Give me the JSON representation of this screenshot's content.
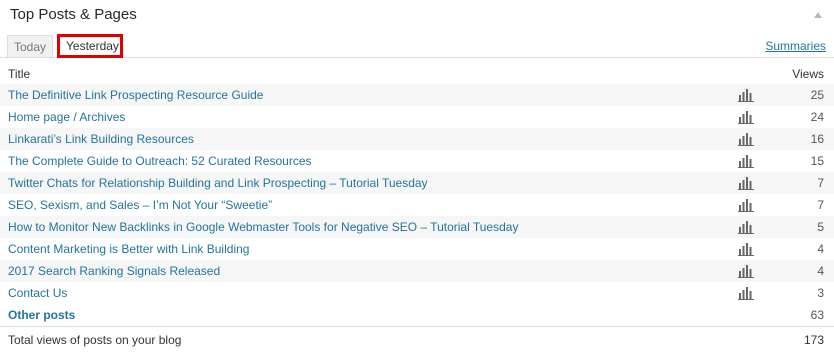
{
  "widget": {
    "title": "Top Posts & Pages",
    "tabs": [
      {
        "label": "Today",
        "active": false
      },
      {
        "label": "Yesterday",
        "active": true
      }
    ],
    "summaries_link": "Summaries",
    "columns": {
      "title": "Title",
      "views": "Views"
    }
  },
  "rows": [
    {
      "title": "The Definitive Link Prospecting Resource Guide",
      "views": "25"
    },
    {
      "title": "Home page / Archives",
      "views": "24"
    },
    {
      "title": "Linkarati’s Link Building Resources",
      "views": "16"
    },
    {
      "title": "The Complete Guide to Outreach: 52 Curated Resources",
      "views": "15"
    },
    {
      "title": "Twitter Chats for Relationship Building and Link Prospecting – Tutorial Tuesday",
      "views": "7"
    },
    {
      "title": "SEO, Sexism, and Sales – I’m Not Your “Sweetie”",
      "views": "7"
    },
    {
      "title": "How to Monitor New Backlinks in Google Webmaster Tools for Negative SEO – Tutorial Tuesday",
      "views": "5"
    },
    {
      "title": "Content Marketing is Better with Link Building",
      "views": "4"
    },
    {
      "title": "2017 Search Ranking Signals Released",
      "views": "4"
    },
    {
      "title": "Contact Us",
      "views": "3"
    }
  ],
  "other_posts": {
    "label": "Other posts",
    "views": "63"
  },
  "total": {
    "label": "Total views of posts on your blog",
    "views": "173"
  },
  "colors": {
    "link": "#21759b",
    "highlight_border": "#e00000",
    "alt_row": "#f6f6f6"
  },
  "icons": {
    "row_stats": "bar-chart-icon",
    "collapse": "triangle-up-icon"
  }
}
